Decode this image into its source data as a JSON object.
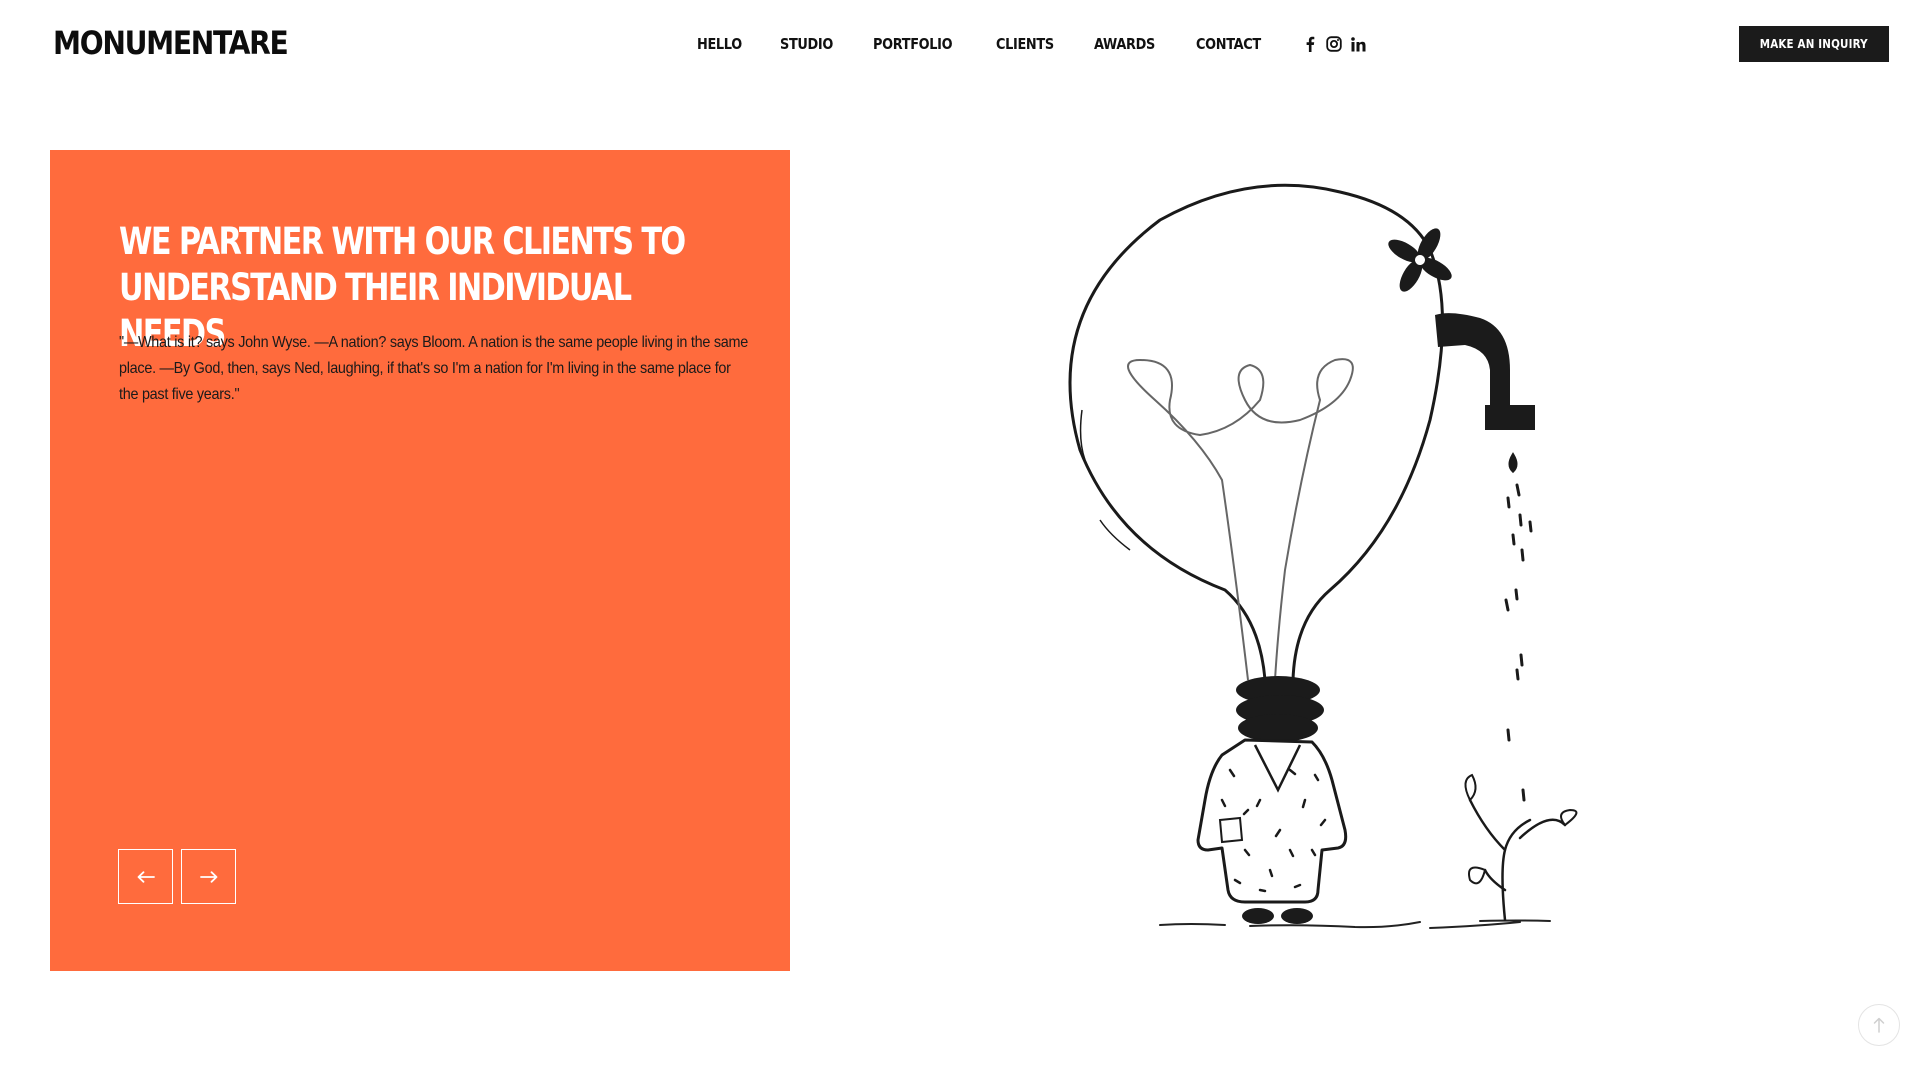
{
  "brand": {
    "name": "MONUMENTARE"
  },
  "nav": {
    "items": [
      {
        "label": "HELLO"
      },
      {
        "label": "STUDIO"
      },
      {
        "label": "PORTFOLIO"
      },
      {
        "label": "CLIENTS"
      },
      {
        "label": "AWARDS"
      },
      {
        "label": "CONTACT"
      }
    ],
    "socials": [
      "facebook-icon",
      "instagram-icon",
      "linkedin-icon"
    ]
  },
  "cta": {
    "label": "MAKE AN INQUIRY"
  },
  "hero": {
    "title": "WE PARTNER WITH OUR CLIENTS TO UNDERSTAND THEIR INDIVIDUAL NEEDS",
    "quote": "\"—What is it? says John Wyse. —A nation? says Bloom. A nation is the same people living in the same place. —By God, then, says Ned, laughing, if that's so I'm a nation for I'm living in the same place for the past five years.\"",
    "prev_icon": "arrow-left-icon",
    "next_icon": "arrow-right-icon"
  },
  "colors": {
    "accent": "#ff6b3d",
    "dark": "#1b1b1b",
    "text_on_accent": "#ffffff"
  },
  "scroll_top_icon": "arrow-up-icon"
}
